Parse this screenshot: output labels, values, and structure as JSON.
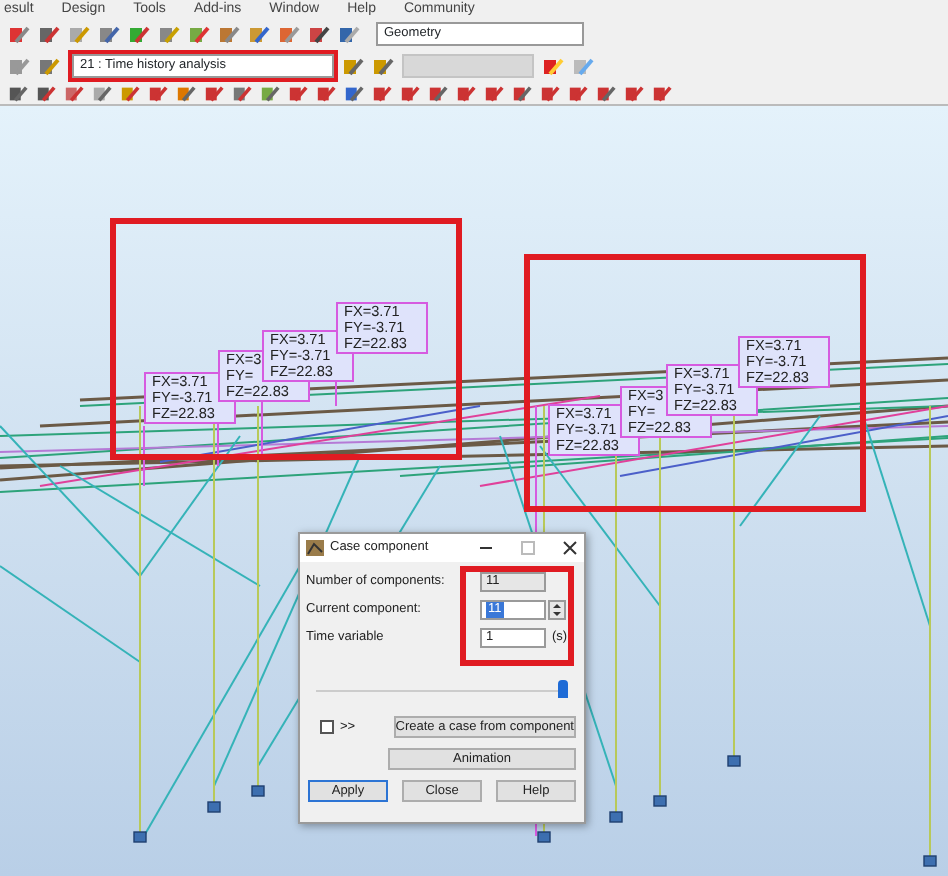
{
  "menu": [
    "esult",
    "Design",
    "Tools",
    "Add-ins",
    "Window",
    "Help",
    "Community"
  ],
  "toolbar": {
    "view_select": "Geometry",
    "case_select": "21 : Time history analysis"
  },
  "load_groups": [
    {
      "labels": [
        {
          "lines": [
            "FX=3.71",
            "FY=-3.71",
            "FZ=22.83"
          ]
        },
        {
          "lines": [
            "FX=3",
            "FY=",
            "FZ=22.83"
          ]
        },
        {
          "lines": [
            "FX=3.71",
            "FY=-3.71",
            "FZ=22.83"
          ]
        },
        {
          "lines": [
            "FX=3.71",
            "FY=-3.71",
            "FZ=22.83"
          ]
        }
      ]
    },
    {
      "labels": [
        {
          "lines": [
            "FX=3.71",
            "FY=-3.71",
            "FZ=22.83"
          ]
        },
        {
          "lines": [
            "FX=3",
            "FY=",
            "FZ=22.83"
          ]
        },
        {
          "lines": [
            "FX=3.71",
            "FY=-3.71",
            "FZ=22.83"
          ]
        },
        {
          "lines": [
            "FX=3.71",
            "FY=-3.71",
            "FZ=22.83"
          ]
        }
      ]
    }
  ],
  "dialog": {
    "title": "Case component",
    "fields": [
      {
        "kind": "readonly",
        "label": "Number of components:",
        "value": "11"
      },
      {
        "kind": "spin",
        "label": "Current component:",
        "value": "11",
        "text_selected": true
      },
      {
        "kind": "text",
        "label": "Time variable",
        "value": "1",
        "unit": "(s)"
      }
    ],
    "slider": {
      "level": 1
    },
    "checkbox": {
      "label": ">>",
      "checked": false
    },
    "buttons": [
      {
        "label": "Create a case from component",
        "default": false
      },
      {
        "label": "Animation",
        "default": false
      },
      {
        "label": "Apply",
        "default": true
      },
      {
        "label": "Close",
        "default": false
      },
      {
        "label": "Help",
        "default": false
      }
    ]
  }
}
